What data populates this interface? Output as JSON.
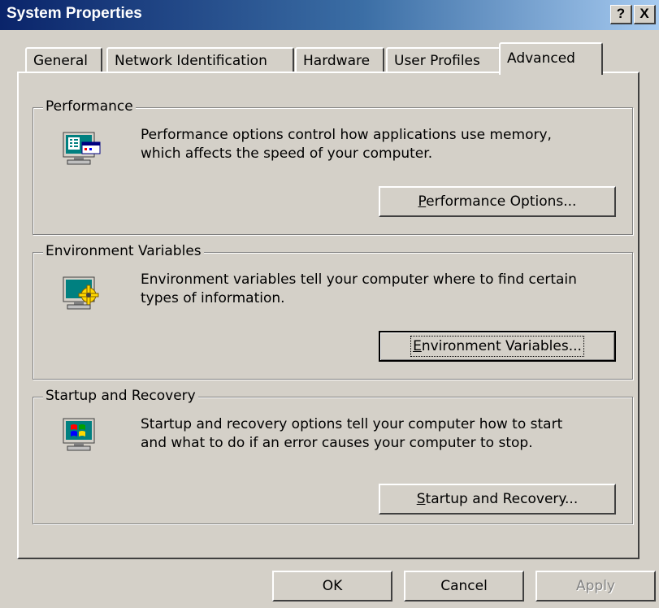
{
  "window": {
    "title": "System Properties",
    "help_button": "?",
    "close_button": "X"
  },
  "tabs": [
    {
      "label": "General",
      "active": false
    },
    {
      "label": "Network Identification",
      "active": false
    },
    {
      "label": "Hardware",
      "active": false
    },
    {
      "label": "User Profiles",
      "active": false
    },
    {
      "label": "Advanced",
      "active": true
    }
  ],
  "groups": {
    "performance": {
      "label": "Performance",
      "icon": "monitor-performance-icon",
      "description_lines": [
        "Performance options control how applications use memory,",
        "which affects the speed of your computer."
      ],
      "button": {
        "mnemonic": "P",
        "rest": "erformance Options..."
      }
    },
    "environment": {
      "label": "Environment Variables",
      "icon": "monitor-gear-icon",
      "description_lines": [
        "Environment variables tell your computer where to find certain",
        "types of information."
      ],
      "button": {
        "mnemonic": "E",
        "rest": "nvironment Variables..."
      }
    },
    "startup": {
      "label": "Startup and Recovery",
      "icon": "monitor-windows-icon",
      "description_lines": [
        "Startup and recovery options tell your computer how to start",
        "and what to do if an error causes your computer to stop."
      ],
      "button": {
        "mnemonic": "S",
        "rest": "tartup and Recovery..."
      }
    }
  },
  "footer": {
    "ok_label": "OK",
    "cancel_label": "Cancel",
    "apply_label": "Apply",
    "apply_enabled": false
  }
}
